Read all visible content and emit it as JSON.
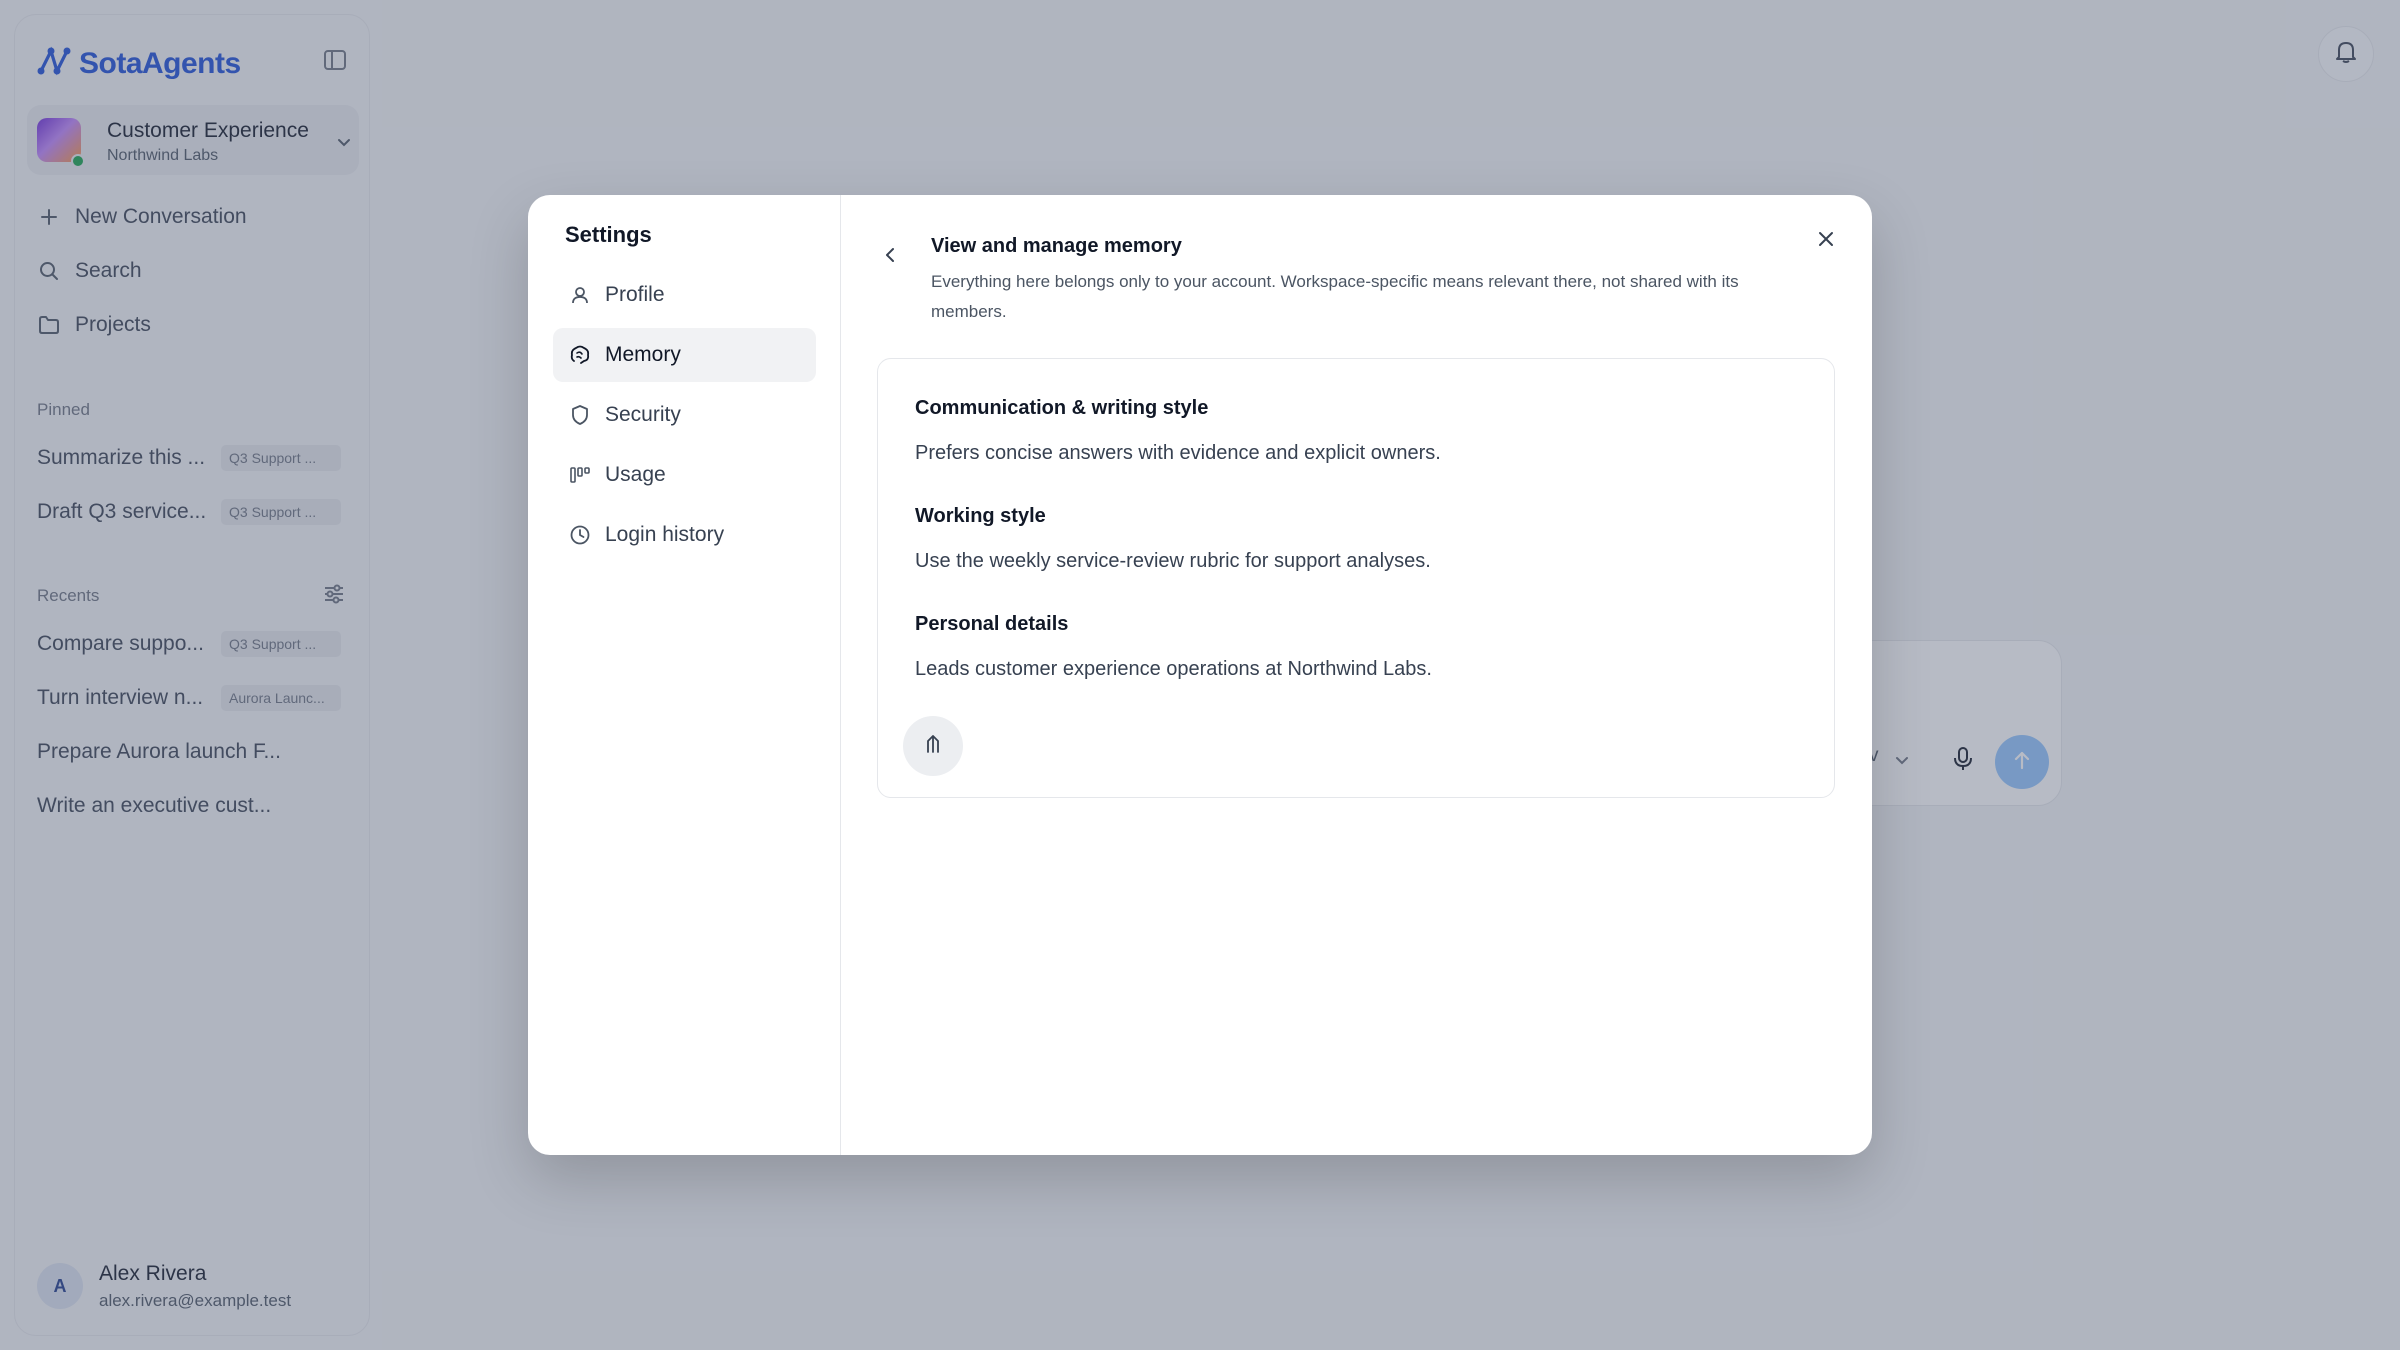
{
  "sidebar": {
    "brand": "SotaAgents",
    "workspace": {
      "name": "Customer Experience",
      "org": "Northwind Labs"
    },
    "nav": {
      "new_conversation": "New Conversation",
      "search": "Search",
      "projects": "Projects"
    },
    "pinned_label": "Pinned",
    "pinned": [
      {
        "title": "Summarize this ...",
        "tag": "Q3 Support ..."
      },
      {
        "title": "Draft Q3 service...",
        "tag": "Q3 Support ..."
      }
    ],
    "recents_label": "Recents",
    "recents": [
      {
        "title": "Compare suppo...",
        "tag": "Q3 Support ..."
      },
      {
        "title": "Turn interview n...",
        "tag": "Aurora Launc..."
      },
      {
        "title": "Prepare Aurora launch F..."
      },
      {
        "title": "Write an executive cust..."
      }
    ],
    "user": {
      "initial": "A",
      "name": "Alex Rivera",
      "email": "alex.rivera@example.test"
    }
  },
  "composer": {
    "model_fragment": "v"
  },
  "settings": {
    "title": "Settings",
    "menu": [
      {
        "label": "Profile",
        "icon": "user-icon"
      },
      {
        "label": "Memory",
        "icon": "brain-icon",
        "active": true
      },
      {
        "label": "Security",
        "icon": "shield-icon"
      },
      {
        "label": "Usage",
        "icon": "usage-icon"
      },
      {
        "label": "Login history",
        "icon": "clock-icon"
      }
    ],
    "pane": {
      "title": "View and manage memory",
      "description": "Everything here belongs only to your account. Workspace-specific means relevant there, not shared with its members.",
      "sections": [
        {
          "heading": "Communication & writing style",
          "text": "Prefers concise answers with evidence and explicit owners."
        },
        {
          "heading": "Working style",
          "text": "Use the weekly service-review rubric for support analyses."
        },
        {
          "heading": "Personal details",
          "text": "Leads customer experience operations at Northwind Labs."
        }
      ]
    }
  },
  "colors": {
    "brand": "#1d4ed8",
    "online": "#16a34a",
    "send_button": "#93c5fd",
    "overlay": "rgba(84,94,116,0.42)"
  }
}
